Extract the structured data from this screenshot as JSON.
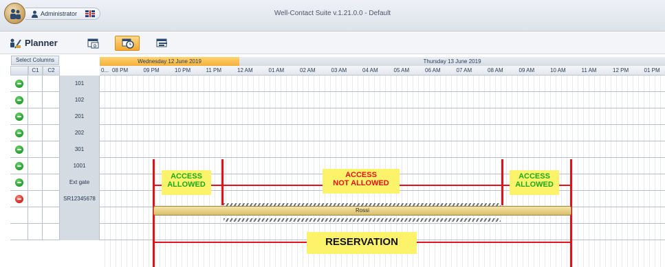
{
  "titlebar": {
    "user": "Administrator",
    "app_title": "Well-Contact Suite v.1.21.0.0 - Default"
  },
  "toolbar": {
    "title": "Planner",
    "buttons": [
      {
        "name": "day-view-icon",
        "active": false
      },
      {
        "name": "clock-view-icon",
        "active": true
      },
      {
        "name": "calendar-view-icon",
        "active": false
      }
    ]
  },
  "grid": {
    "select_columns": "Select Columns",
    "col_c1": "C1",
    "col_c2": "C2",
    "days": {
      "wed": "Wednesday 12 June 2019",
      "thu": "Thursday 13 June 2019"
    },
    "hours": [
      "0...",
      "08 PM",
      "09 PM",
      "10 PM",
      "11 PM",
      "12 AM",
      "01 AM",
      "02 AM",
      "03 AM",
      "04 AM",
      "05 AM",
      "06 AM",
      "07 AM",
      "08 AM",
      "09 AM",
      "10 AM",
      "11 AM",
      "12 PM",
      "01 PM"
    ],
    "rows": [
      {
        "name": "101",
        "status": "green"
      },
      {
        "name": "102",
        "status": "green"
      },
      {
        "name": "201",
        "status": "green"
      },
      {
        "name": "202",
        "status": "green"
      },
      {
        "name": "301",
        "status": "green"
      },
      {
        "name": "1001",
        "status": "green"
      },
      {
        "name": "Ext gate",
        "status": "green"
      },
      {
        "name": "SR12345678",
        "status": "red"
      },
      {
        "name": "",
        "status": ""
      },
      {
        "name": "",
        "status": ""
      }
    ]
  },
  "reservation_bar": {
    "label": "Rossi"
  },
  "annotations": {
    "access_allowed_1": "ACCESS\nALLOWED",
    "access_not_allowed": "ACCESS\nNOT ALLOWED",
    "access_allowed_2": "ACCESS\nALLOWED",
    "reservation": "RESERVATION"
  }
}
